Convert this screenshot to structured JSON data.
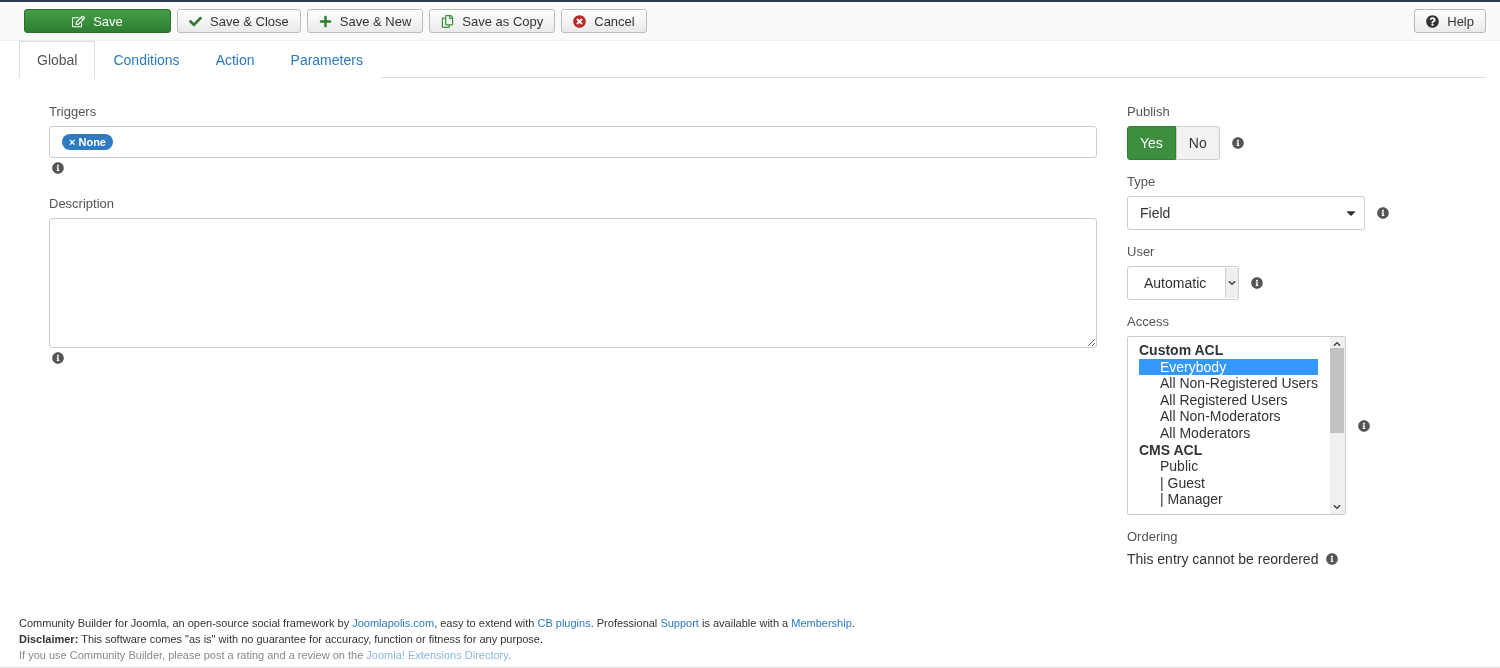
{
  "toolbar": {
    "buttons": [
      {
        "label": "Save",
        "kind": "save"
      },
      {
        "label": "Save & Close",
        "kind": "close"
      },
      {
        "label": "Save & New",
        "kind": "new"
      },
      {
        "label": "Save as Copy",
        "kind": "copy"
      },
      {
        "label": "Cancel",
        "kind": "cancel"
      }
    ],
    "help": {
      "label": "Help"
    }
  },
  "tabs": [
    {
      "label": "Global",
      "selected": true
    },
    {
      "label": "Conditions",
      "selected": false
    },
    {
      "label": "Action",
      "selected": false
    },
    {
      "label": "Parameters",
      "selected": false
    }
  ],
  "triggers": {
    "label": "Triggers",
    "tags": [
      "× None"
    ]
  },
  "description": {
    "label": "Description"
  },
  "publish": {
    "label": "Publish",
    "options": [
      {
        "label": "Yes",
        "selected": true
      },
      {
        "label": "No",
        "selected": false
      }
    ]
  },
  "type": {
    "label": "Type",
    "value": "Field"
  },
  "user": {
    "label": "User",
    "value": "Automatic"
  },
  "access": {
    "label": "Access",
    "groups": [
      {
        "label": "Custom ACL",
        "options": [
          {
            "label": "Everybody",
            "selected": true
          },
          {
            "label": "All Non-Registered Users",
            "selected": false
          },
          {
            "label": "All Registered Users",
            "selected": false
          },
          {
            "label": "All Non-Moderators",
            "selected": false
          },
          {
            "label": "All Moderators",
            "selected": false
          }
        ]
      },
      {
        "label": "CMS ACL",
        "options": [
          {
            "label": "Public",
            "selected": false
          },
          {
            "label": "| Guest",
            "selected": false
          },
          {
            "label": "| Manager",
            "selected": false
          }
        ]
      }
    ]
  },
  "ordering": {
    "label": "Ordering",
    "text": "This entry cannot be reordered"
  },
  "footer": [
    {
      "parts": [
        {
          "text": "Community Builder for Joomla, an open-source social framework by "
        },
        {
          "text": "Joomlapolis.com",
          "link": true
        },
        {
          "text": ", easy to extend with "
        },
        {
          "text": "CB plugins",
          "link": true
        },
        {
          "text": ". Professional "
        },
        {
          "text": "Support",
          "link": true
        },
        {
          "text": " is available with a "
        },
        {
          "text": "Membership",
          "link": true
        },
        {
          "text": "."
        }
      ],
      "muted": false
    },
    {
      "parts": [
        {
          "text": "**Disclaimer:** This software comes \"as is\" with no guarantee for accuracy, function or fitness for any purpose."
        }
      ],
      "muted": false
    },
    {
      "parts": [
        {
          "text": "If you use Community Builder, please post a rating and a review on the "
        },
        {
          "text": "Joomla! Extensions Directory",
          "link": true
        },
        {
          "text": "."
        }
      ],
      "muted": true
    }
  ]
}
